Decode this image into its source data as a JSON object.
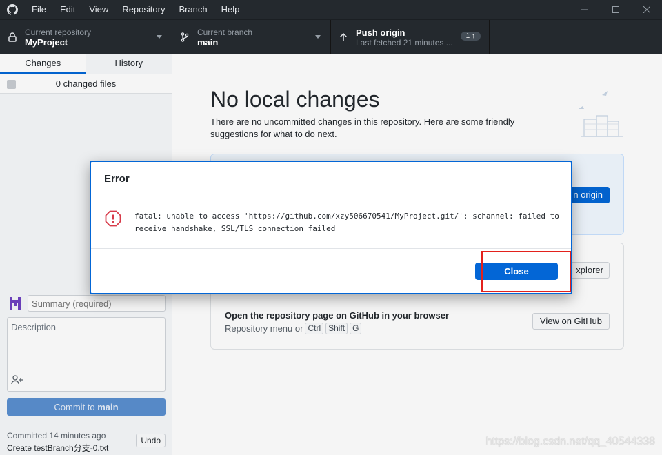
{
  "menu": [
    "File",
    "Edit",
    "View",
    "Repository",
    "Branch",
    "Help"
  ],
  "toolbar": {
    "repo_label": "Current repository",
    "repo_value": "MyProject",
    "branch_label": "Current branch",
    "branch_value": "main",
    "push_label": "Push origin",
    "push_sub": "Last fetched 21 minutes ...",
    "push_badge": "1 ↑"
  },
  "sidebar": {
    "tab_changes": "Changes",
    "tab_history": "History",
    "changed_files": "0 changed files",
    "summary_placeholder": "Summary (required)",
    "description_placeholder": "Description",
    "commit_prefix": "Commit to ",
    "commit_branch": "main",
    "last_commit_title": "Committed 14 minutes ago",
    "last_commit_msg": "Create testBranch分支-0.txt",
    "undo_label": "Undo"
  },
  "main": {
    "title": "No local changes",
    "description": "There are no uncommitted changes in this repository. Here are some friendly suggestions for what to do next.",
    "card1_button_visible": "n origin",
    "card2_button_visible": "xplorer",
    "gh_page_title": "Open the repository page on GitHub in your browser",
    "gh_page_sub": "Repository menu or",
    "shortcut_keys": [
      "Ctrl",
      "Shift",
      "G"
    ],
    "view_button": "View on GitHub"
  },
  "dialog": {
    "title": "Error",
    "message": "fatal: unable to access 'https://github.com/xzy506670541/MyProject.git/': schannel: failed to receive handshake, SSL/TLS connection failed",
    "close_label": "Close"
  },
  "watermark": "https://blog.csdn.net/qq_40544338",
  "colors": {
    "accent": "#0366d6",
    "dark_bar": "#24292e",
    "highlight": "#e3211c"
  }
}
